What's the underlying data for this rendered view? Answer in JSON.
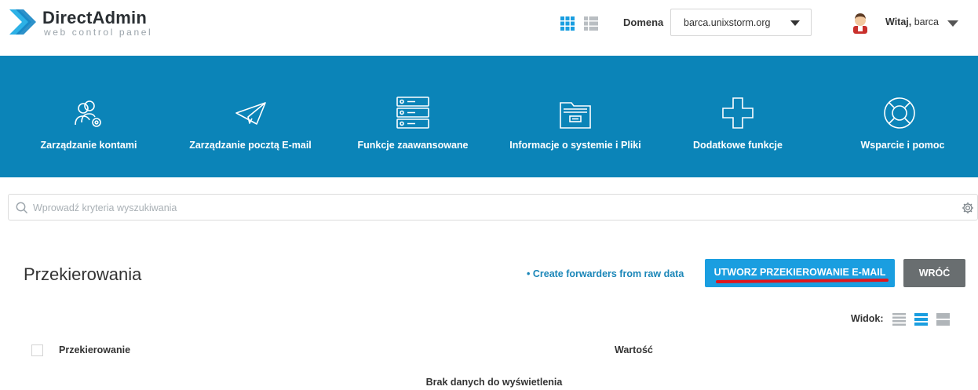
{
  "header": {
    "logo_title": "DirectAdmin",
    "logo_subtitle": "web control panel",
    "domain_label": "Domena",
    "domain_value": "barca.unixstorm.org",
    "welcome_prefix": "Witaj,",
    "username": "barca",
    "view_icons": [
      "grid-view-icon",
      "list-view-icon"
    ]
  },
  "nav": {
    "items": [
      {
        "label": "Zarządzanie kontami",
        "icon": "users-gear-icon"
      },
      {
        "label": "Zarządzanie pocztą E-mail",
        "icon": "paper-plane-icon"
      },
      {
        "label": "Funkcje zaawansowane",
        "icon": "server-stack-icon"
      },
      {
        "label": "Informacje o systemie i Pliki",
        "icon": "file-cabinet-icon"
      },
      {
        "label": "Dodatkowe funkcje",
        "icon": "plus-icon"
      },
      {
        "label": "Wsparcie i pomoc",
        "icon": "lifebuoy-icon"
      }
    ]
  },
  "search": {
    "placeholder": "Wprowadź kryteria wyszukiwania",
    "value": ""
  },
  "page": {
    "title": "Przekierowania",
    "raw_link": "• Create forwarders from raw data",
    "create_button": "UTWORZ PRZEKIEROWANIE E-MAIL",
    "back_button": "WRÓĆ",
    "view_label": "Widok:"
  },
  "table": {
    "columns": [
      "Przekierowanie",
      "Wartość"
    ],
    "empty_message": "Brak danych do wyświetlenia"
  },
  "colors": {
    "band": "#0b84b8",
    "primary_button": "#1a9ee0",
    "secondary_button": "#696e70",
    "link": "#1a86b8",
    "annotation_underline": "#e2161c"
  }
}
